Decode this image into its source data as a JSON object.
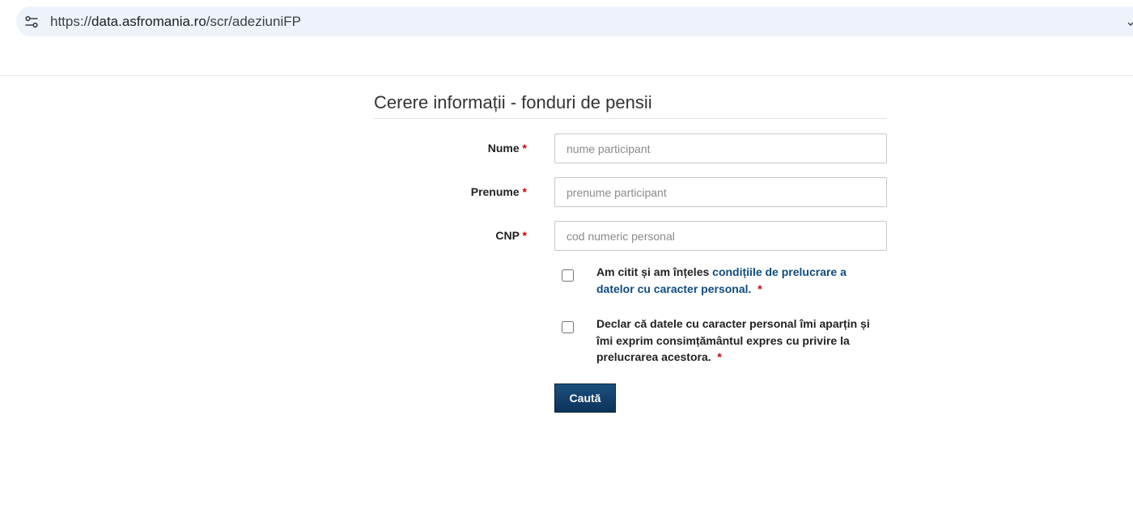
{
  "browser": {
    "url_scheme": "https://",
    "url_host": "data.asfromania.ro",
    "url_path": "/scr/adeziuniFP",
    "site_info_icon": "tune-icon"
  },
  "form": {
    "title": "Cerere informații - fonduri de pensii",
    "required_marker": "*",
    "fields": [
      {
        "label": "Nume",
        "placeholder": "nume participant",
        "value": ""
      },
      {
        "label": "Prenume",
        "placeholder": "prenume participant",
        "value": ""
      },
      {
        "label": "CNP",
        "placeholder": "cod numeric personal",
        "value": ""
      }
    ],
    "consents": [
      {
        "checked": false,
        "text_before": "Am citit și am înțeles ",
        "link_text": "condițiile de prelucrare a datelor cu caracter personal.",
        "text_after": ""
      },
      {
        "checked": false,
        "text_before": "Declar că datele cu caracter personal îmi aparțin și îmi exprim consimțământul expres cu privire la prelucrarea acestora.",
        "link_text": "",
        "text_after": ""
      }
    ],
    "submit_label": "Caută"
  },
  "colors": {
    "required": "#cc0000",
    "link": "#0f4c81",
    "button": "#0c3358",
    "urlbar": "#eef3fb"
  }
}
